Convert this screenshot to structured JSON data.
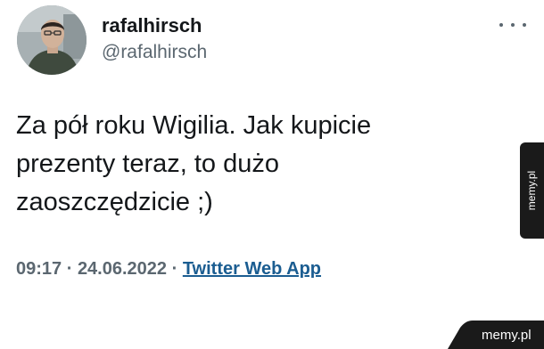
{
  "tweet": {
    "display_name": "rafalhirsch",
    "handle": "@rafalhirsch",
    "more_icon": "more-horizontal-icon",
    "text": "Za pół roku Wigilia. Jak kupicie\nprezenty teraz, to dużo\nzaoszczędzicie ;)",
    "time": "09:17",
    "date": "24.06.2022",
    "separator": " · ",
    "source": "Twitter Web App"
  },
  "watermark": {
    "side_text": "memy.pl",
    "corner_text": "memy.pl"
  },
  "colors": {
    "text_primary": "#14171a",
    "text_secondary": "#5b6770",
    "link": "#1b5d91",
    "watermark_bg": "#1a1a1a"
  }
}
